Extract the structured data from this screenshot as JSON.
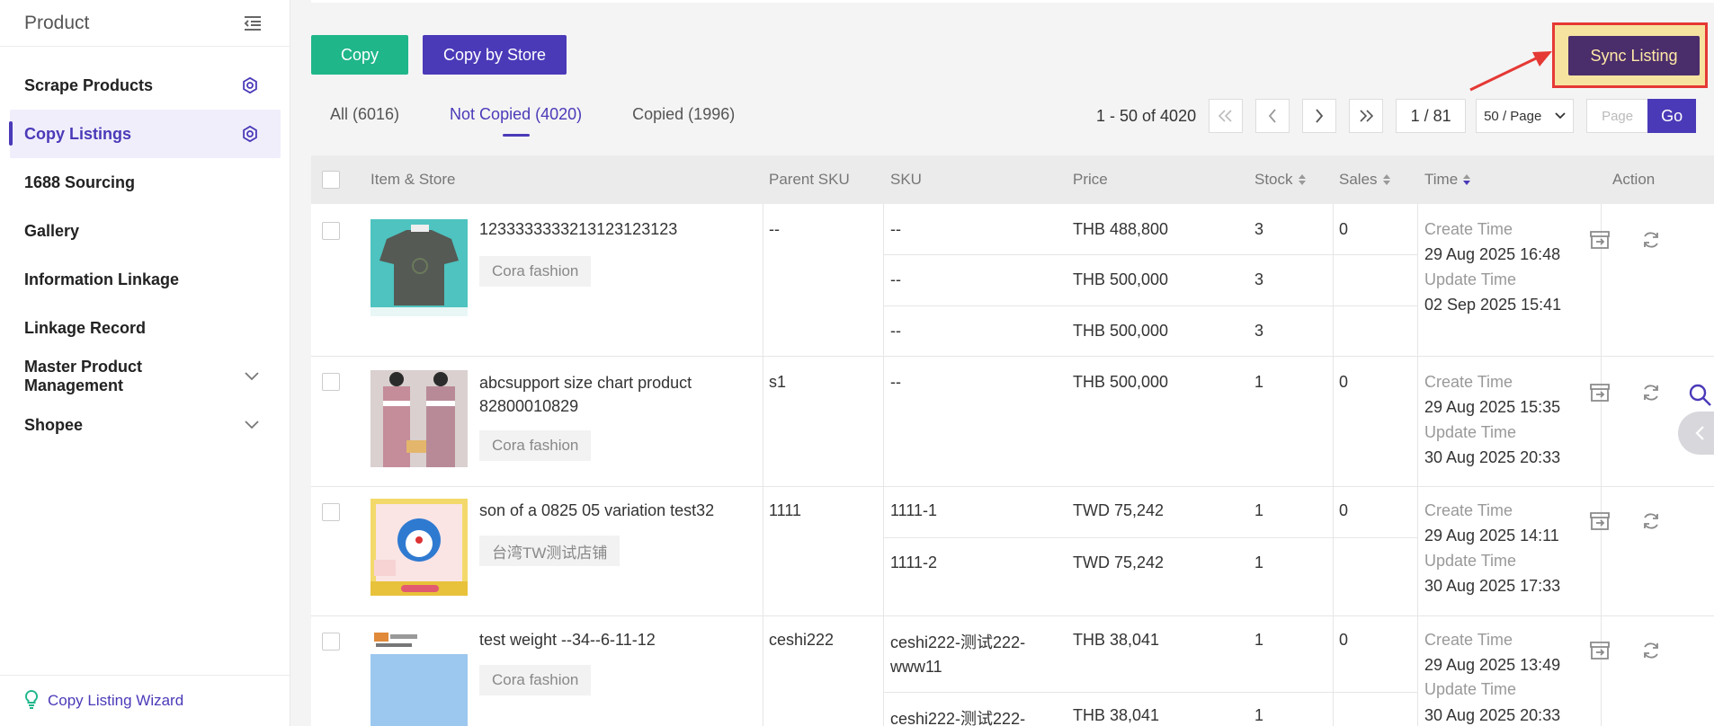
{
  "sidebar": {
    "title": "Product",
    "items": [
      {
        "label": "Scrape Products",
        "has_gear": true
      },
      {
        "label": "Copy Listings",
        "has_gear": true,
        "active": true
      },
      {
        "label": "1688 Sourcing"
      },
      {
        "label": "Gallery"
      },
      {
        "label": "Information Linkage"
      },
      {
        "label": "Linkage Record"
      },
      {
        "label": "Master Product Management",
        "expandable": true
      },
      {
        "label": "Shopee",
        "expandable": true
      }
    ],
    "footer": {
      "label": "Copy Listing Wizard",
      "icon": "lightbulb-icon"
    }
  },
  "toolbar": {
    "copy_label": "Copy",
    "copy_by_store_label": "Copy by Store",
    "sync_label": "Sync Listing"
  },
  "tabs": [
    {
      "label": "All (6016)"
    },
    {
      "label": "Not Copied (4020)",
      "active": true
    },
    {
      "label": "Copied (1996)"
    }
  ],
  "pager": {
    "range": "1 - 50 of 4020",
    "page": "1 / 81",
    "page_size": "50 / Page",
    "goto_placeholder": "Page",
    "go_label": "Go"
  },
  "table": {
    "headers": {
      "item": "Item & Store",
      "parent_sku": "Parent SKU",
      "sku": "SKU",
      "price": "Price",
      "stock": "Stock",
      "sales": "Sales",
      "time": "Time",
      "action": "Action"
    },
    "rows": [
      {
        "title": "1233333333213123123123",
        "store": "Cora fashion",
        "parent_sku": "--",
        "variants": [
          {
            "sku": "--",
            "price": "THB 488,800",
            "stock": "3"
          },
          {
            "sku": "--",
            "price": "THB 500,000",
            "stock": "3"
          },
          {
            "sku": "--",
            "price": "THB 500,000",
            "stock": "3"
          }
        ],
        "sales": "0",
        "create_label": "Create Time",
        "create": "29 Aug 2025 16:48",
        "update_label": "Update Time",
        "update": "02 Sep 2025 15:41"
      },
      {
        "title": "abcsupport size chart product 82800010829",
        "store": "Cora fashion",
        "parent_sku": "s1",
        "variants": [
          {
            "sku": "--",
            "price": "THB 500,000",
            "stock": "1"
          }
        ],
        "sales": "0",
        "create_label": "Create Time",
        "create": "29 Aug 2025 15:35",
        "update_label": "Update Time",
        "update": "30 Aug 2025 20:33"
      },
      {
        "title": "son of a 0825 05 variation test32",
        "store": "台湾TW测试店铺",
        "parent_sku": "1111",
        "variants": [
          {
            "sku": "1111-1",
            "price": "TWD 75,242",
            "stock": "1"
          },
          {
            "sku": "1111-2",
            "price": "TWD 75,242",
            "stock": "1"
          }
        ],
        "sales": "0",
        "create_label": "Create Time",
        "create": "29 Aug 2025 14:11",
        "update_label": "Update Time",
        "update": "30 Aug 2025 17:33"
      },
      {
        "title": "test weight --34--6-11-12",
        "store": "Cora fashion",
        "parent_sku": "ceshi222",
        "variants": [
          {
            "sku": "ceshi222-测试222-www11",
            "price": "THB 38,041",
            "stock": "1"
          },
          {
            "sku": "ceshi222-测试222-",
            "price": "THB 38,041",
            "stock": "1"
          }
        ],
        "sales": "0",
        "create_label": "Create Time",
        "create": "29 Aug 2025 13:49",
        "update_label": "Update Time",
        "update": "30 Aug 2025 20:33"
      }
    ]
  },
  "colors": {
    "primary": "#4a3ab8",
    "green": "#1fb68a",
    "highlight_border": "#e53935",
    "highlight_bg": "#f6e3a0"
  }
}
